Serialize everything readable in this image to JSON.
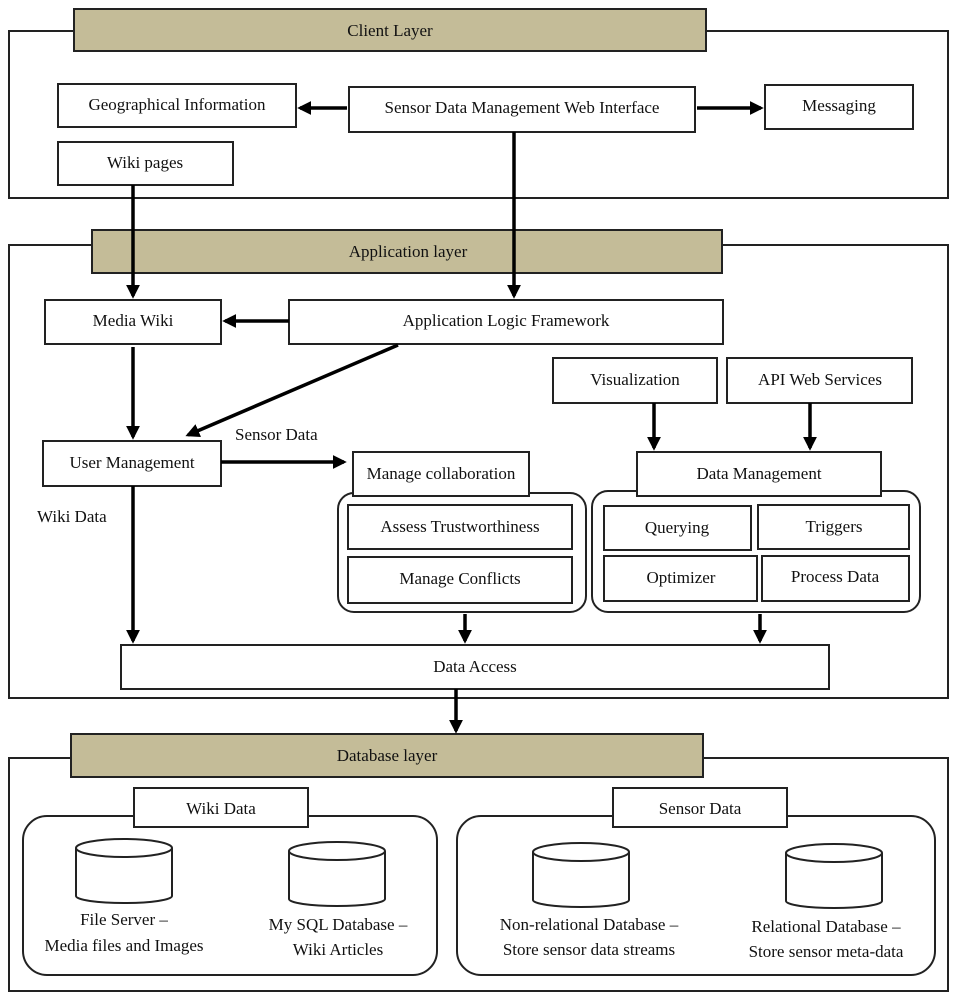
{
  "colors": {
    "layer_banner": "#c4bc98",
    "stroke": "#222222",
    "background": "#ffffff"
  },
  "client_layer": {
    "title": "Client Layer",
    "geographical_information": "Geographical Information",
    "web_interface": "Sensor Data Management Web Interface",
    "messaging": "Messaging",
    "wiki_pages": "Wiki pages"
  },
  "application_layer": {
    "title": "Application layer",
    "media_wiki": "Media Wiki",
    "logic_framework": "Application Logic Framework",
    "visualization": "Visualization",
    "api_web_services": "API Web Services",
    "user_management": "User Management",
    "sensor_data_label": "Sensor Data",
    "wiki_data_label": "Wiki Data",
    "manage_collaboration": {
      "title": "Manage collaboration",
      "items": [
        "Assess Trustworthiness",
        "Manage Conflicts"
      ]
    },
    "data_management": {
      "title": "Data Management",
      "items": [
        "Querying",
        "Triggers",
        "Optimizer",
        "Process Data"
      ]
    },
    "data_access": "Data Access"
  },
  "database_layer": {
    "title": "Database layer",
    "wiki_data": {
      "title": "Wiki Data",
      "databases": [
        {
          "line1": "File Server –",
          "line2": "Media files and Images"
        },
        {
          "line1": "My SQL Database –",
          "line2": "Wiki Articles"
        }
      ]
    },
    "sensor_data": {
      "title": "Sensor Data",
      "databases": [
        {
          "line1": "Non-relational Database –",
          "line2": "Store sensor data streams"
        },
        {
          "line1": "Relational Database –",
          "line2": "Store sensor meta-data"
        }
      ]
    }
  }
}
